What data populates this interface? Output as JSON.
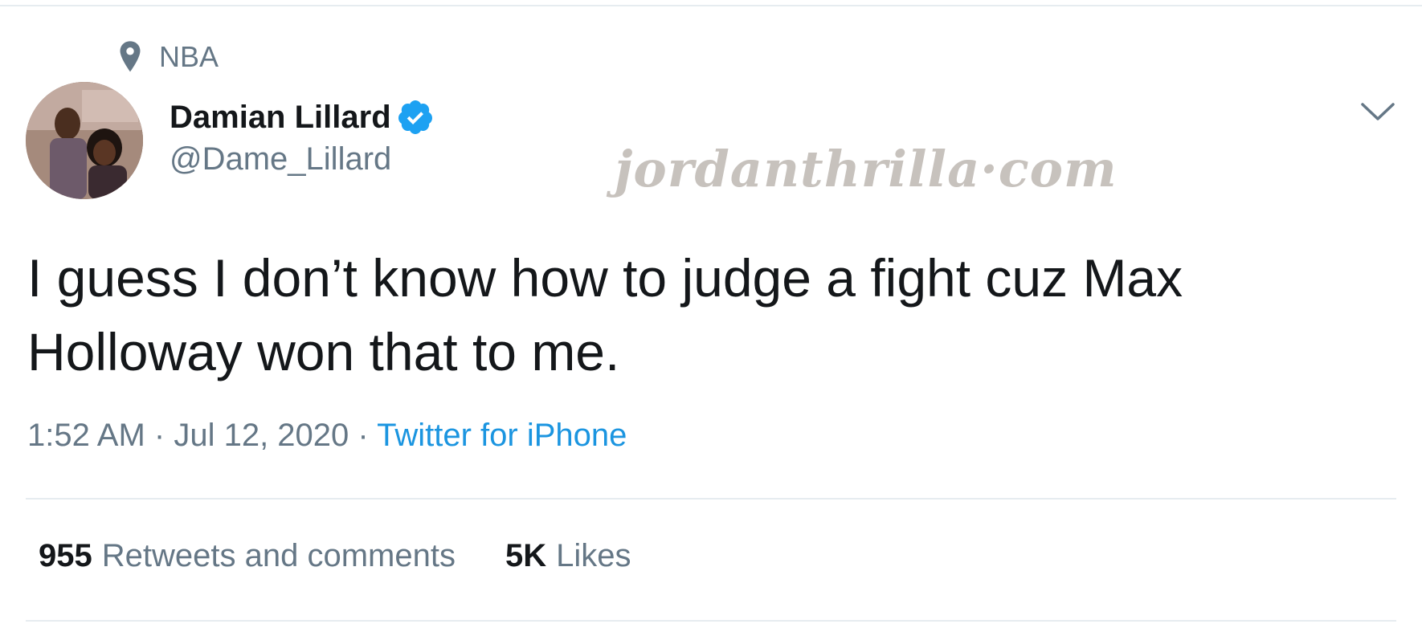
{
  "context": {
    "label": "NBA",
    "icon": "location-pin-icon"
  },
  "author": {
    "display_name": "Damian Lillard",
    "handle": "@Dame_Lillard",
    "verified_icon": "verified-badge-icon"
  },
  "watermark": "jordanthrilla·com",
  "tweet": {
    "text": "I guess I don’t know how to judge a fight cuz Max Holloway won that to me."
  },
  "meta": {
    "time": "1:52 AM",
    "separator": "·",
    "date": "Jul 12, 2020",
    "source": "Twitter for iPhone"
  },
  "stats": {
    "retweets_count": "955",
    "retweets_label": "Retweets and comments",
    "likes_count": "5K",
    "likes_label": "Likes"
  },
  "colors": {
    "accent": "#1b95e0",
    "verified": "#1da1f2",
    "secondary_text": "#657786",
    "divider": "#e6ecf0"
  }
}
